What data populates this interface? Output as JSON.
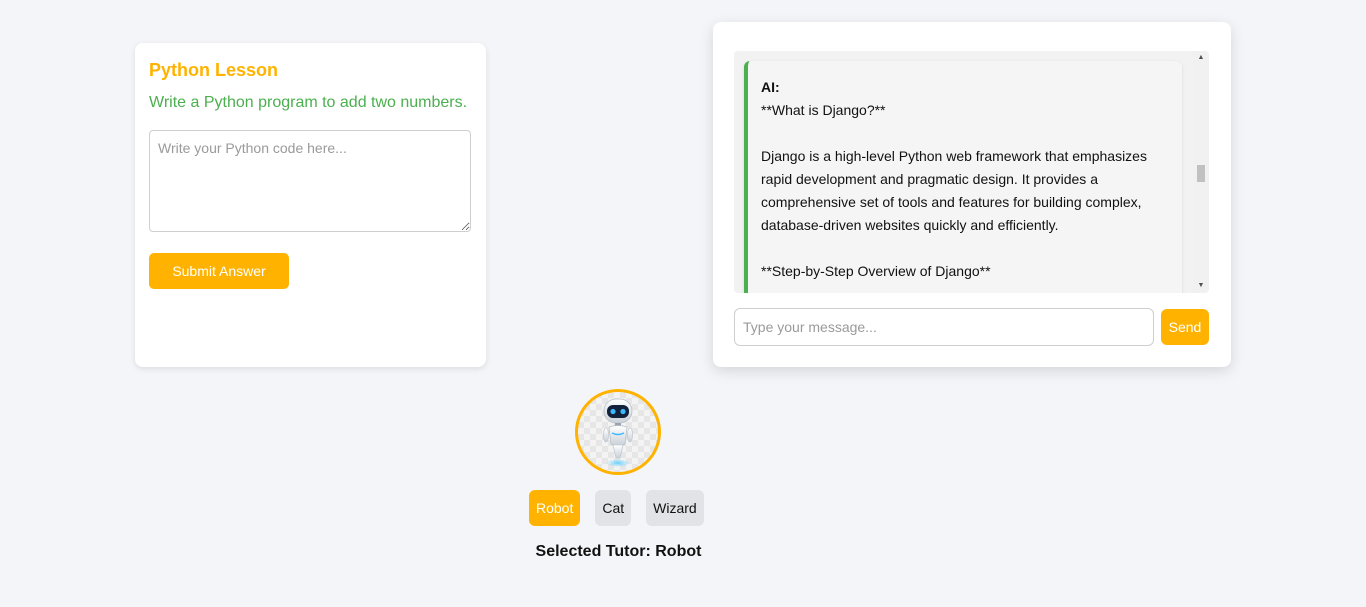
{
  "lesson": {
    "title": "Python Lesson",
    "question": "Write a Python program to add two numbers.",
    "code_placeholder": "Write your Python code here...",
    "submit_label": "Submit Answer"
  },
  "chat": {
    "message": {
      "sender": "AI:",
      "lines": [
        "**What is Django?**",
        "",
        "Django is a high-level Python web framework that emphasizes",
        "rapid development and pragmatic design. It provides a",
        "comprehensive set of tools and features for building complex,",
        "database-driven websites quickly and efficiently.",
        "",
        "**Step-by-Step Overview of Django**",
        ""
      ]
    },
    "input_placeholder": "Type your message...",
    "send_label": "Send",
    "scroll_up_glyph": "▲",
    "scroll_down_glyph": "▼"
  },
  "tutor": {
    "avatar_icon": "robot-icon",
    "options": [
      "Robot",
      "Cat",
      "Wizard"
    ],
    "selected_index": 0,
    "selected_text": "Selected Tutor: Robot"
  },
  "colors": {
    "accent": "#ffb300",
    "success": "#4caf50",
    "background": "#f4f5f9"
  }
}
